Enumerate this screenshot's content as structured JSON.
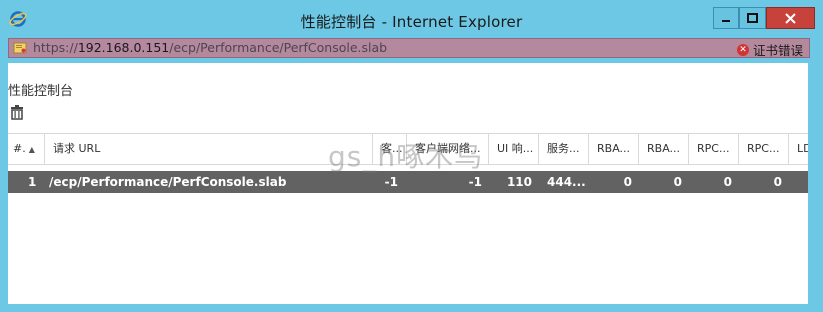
{
  "window": {
    "title": "性能控制台 - Internet Explorer",
    "controls": {
      "minimize": "−",
      "maximize": "□",
      "close": "✕"
    }
  },
  "address": {
    "url_prefix": "https://",
    "url_host": "192.168.0.151",
    "url_path": "/ecp/Performance/PerfConsole.slab",
    "cert_error": "证书错误"
  },
  "page": {
    "title": "性能控制台"
  },
  "table": {
    "headers": [
      "#.",
      "请求 URL",
      "客...",
      "客户端网络...",
      "UI 响...",
      "服务...",
      "RBA...",
      "RBA...",
      "RPC...",
      "RPC...",
      "LD"
    ],
    "sort_indicator": "▲",
    "rows": [
      [
        "1",
        "/ecp/Performance/PerfConsole.slab",
        "-1",
        "-1",
        "110",
        "444....",
        "0",
        "0",
        "0",
        "0",
        ""
      ]
    ]
  },
  "watermark": "gs_h啄木鸟",
  "colors": {
    "titlebar": "#6cc8e4",
    "address_bg": "#b4899d",
    "close_button": "#c7423a",
    "selected_row": "#626262"
  },
  "icons": [
    "ie-logo-icon",
    "certificate-page-icon",
    "cert-error-icon",
    "trash-icon"
  ]
}
